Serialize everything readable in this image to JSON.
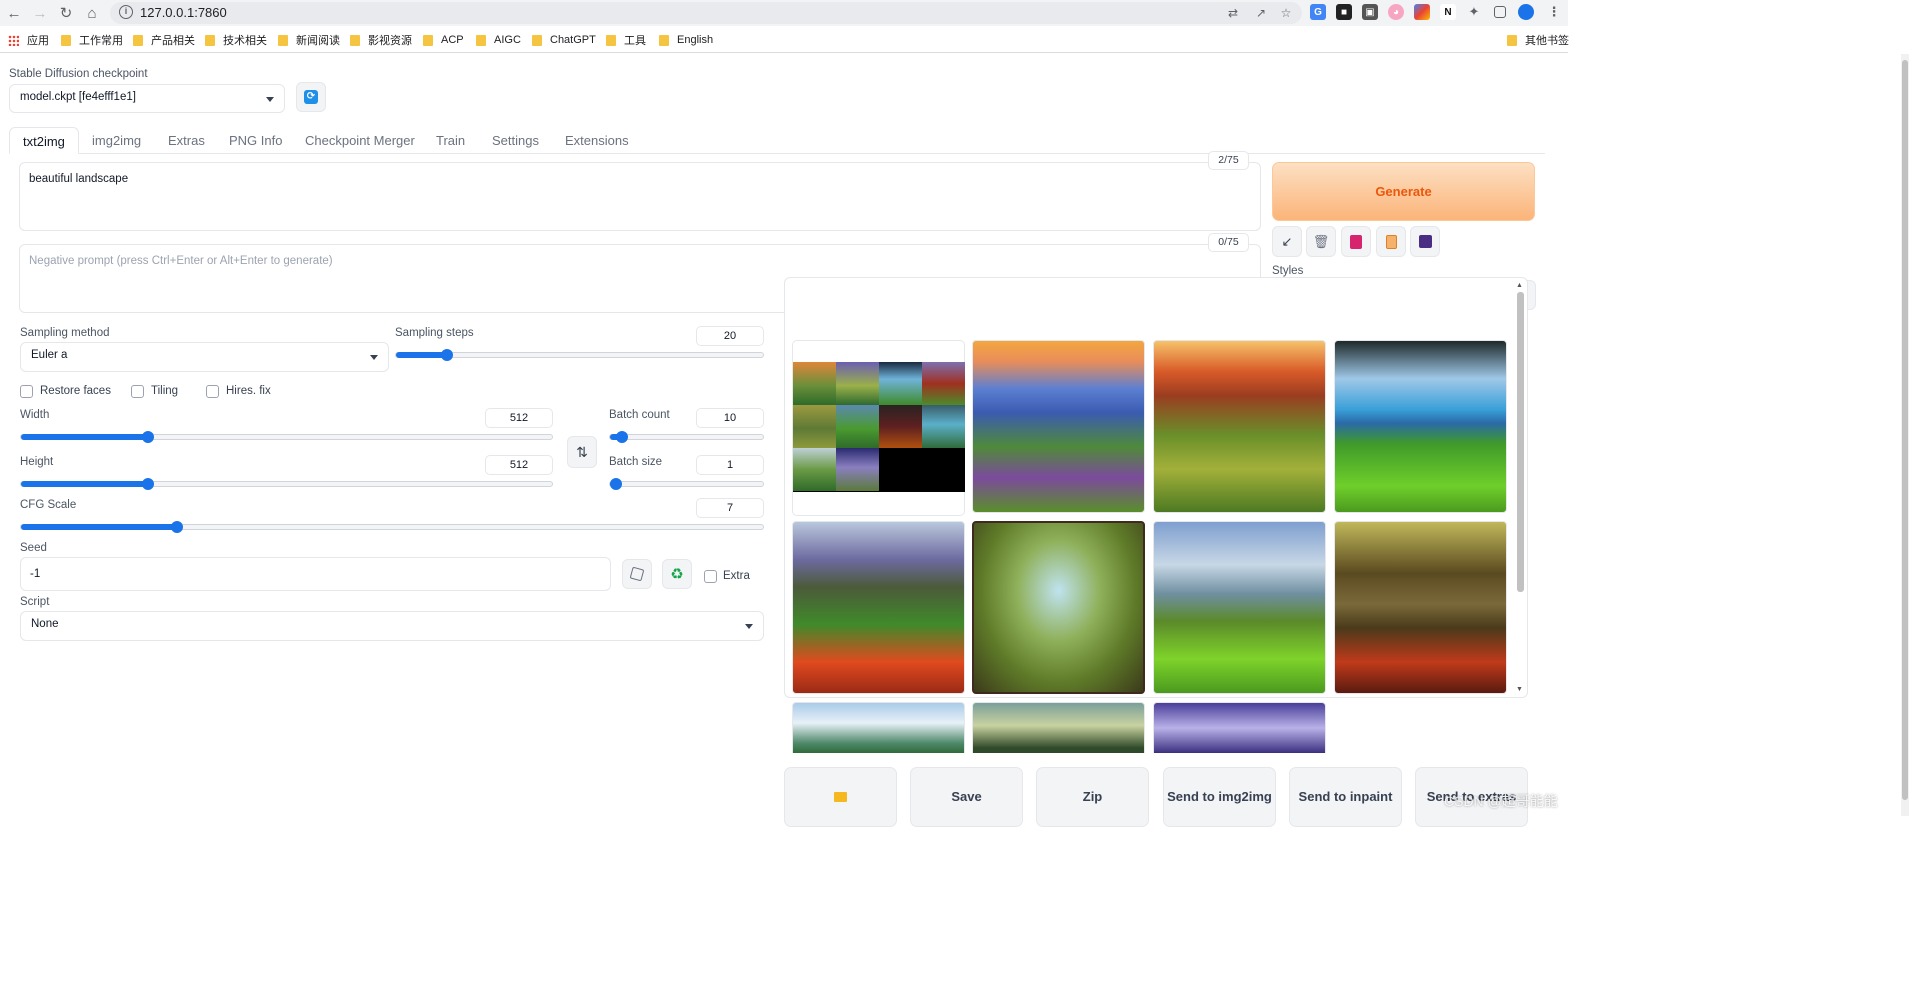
{
  "browser": {
    "url": "127.0.0.1:7860",
    "bookmarks": [
      {
        "label": "应用",
        "kind": "apps"
      },
      {
        "label": "工作常用",
        "kind": "folder"
      },
      {
        "label": "产品相关",
        "kind": "folder"
      },
      {
        "label": "技术相关",
        "kind": "folder"
      },
      {
        "label": "新闻阅读",
        "kind": "folder"
      },
      {
        "label": "影视资源",
        "kind": "folder"
      },
      {
        "label": "ACP",
        "kind": "folder"
      },
      {
        "label": "AIGC",
        "kind": "folder"
      },
      {
        "label": "ChatGPT",
        "kind": "folder"
      },
      {
        "label": "工具",
        "kind": "folder"
      },
      {
        "label": "English",
        "kind": "folder"
      }
    ],
    "other_bookmarks": "其他书签",
    "extension_n_label": "N"
  },
  "checkpoint": {
    "label": "Stable Diffusion checkpoint",
    "value": "model.ckpt [fe4efff1e1]"
  },
  "tabs": [
    "txt2img",
    "img2img",
    "Extras",
    "PNG Info",
    "Checkpoint Merger",
    "Train",
    "Settings",
    "Extensions"
  ],
  "active_tab": "txt2img",
  "prompt": {
    "value": "beautiful landscape",
    "token_count": "2/75"
  },
  "negative_prompt": {
    "placeholder": "Negative prompt (press Ctrl+Enter or Alt+Enter to generate)",
    "token_count": "0/75"
  },
  "generate_label": "Generate",
  "styles": {
    "label": "Styles",
    "clear_glyph": "×"
  },
  "sampling": {
    "method_label": "Sampling method",
    "method_value": "Euler a",
    "steps_label": "Sampling steps",
    "steps_value": "20",
    "steps_fraction": 0.14
  },
  "checkboxes": {
    "restore_faces": "Restore faces",
    "tiling": "Tiling",
    "hires_fix": "Hires. fix",
    "extra": "Extra"
  },
  "width": {
    "label": "Width",
    "value": "512",
    "fraction": 0.24
  },
  "height": {
    "label": "Height",
    "value": "512",
    "fraction": 0.24
  },
  "batch_count": {
    "label": "Batch count",
    "value": "10",
    "fraction": 0.08
  },
  "batch_size": {
    "label": "Batch size",
    "value": "1",
    "fraction": 0.0
  },
  "cfg": {
    "label": "CFG Scale",
    "value": "7",
    "fraction": 0.21
  },
  "seed": {
    "label": "Seed",
    "value": "-1"
  },
  "script": {
    "label": "Script",
    "value": "None"
  },
  "swap_glyph": "⇅",
  "bottom_buttons": {
    "folder": "📁",
    "save": "Save",
    "zip": "Zip",
    "send_img2img": "Send to img2img",
    "send_inpaint": "Send to inpaint",
    "send_extras": "Send to extras"
  },
  "watermark": "CSDN @超哥能能",
  "colors": {
    "accent_blue": "#1a73e8",
    "generate_orange": "#ea580c"
  }
}
